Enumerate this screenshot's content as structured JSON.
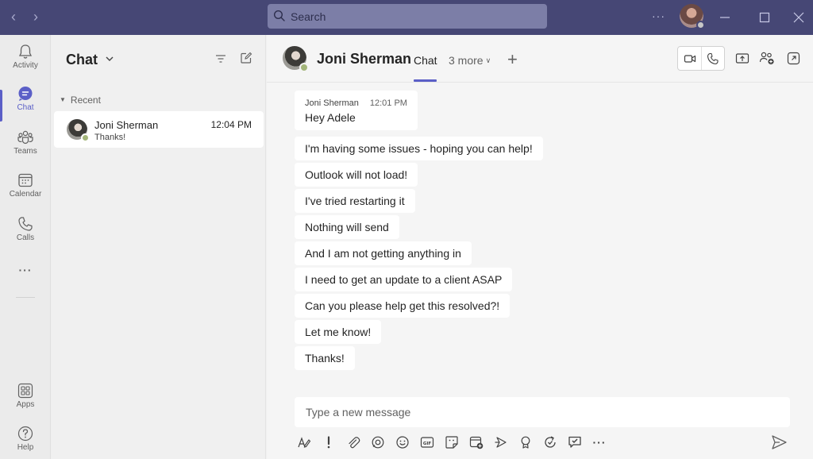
{
  "titlebar": {
    "search_placeholder": "Search",
    "more_label": "···"
  },
  "rail": {
    "items": [
      {
        "label": "Activity"
      },
      {
        "label": "Chat"
      },
      {
        "label": "Teams"
      },
      {
        "label": "Calendar"
      },
      {
        "label": "Calls"
      },
      {
        "label": "Apps"
      },
      {
        "label": "Help"
      }
    ],
    "more_label": "···",
    "active": "Chat"
  },
  "chatlist": {
    "title": "Chat",
    "section": "Recent",
    "items": [
      {
        "name": "Joni Sherman",
        "time": "12:04 PM",
        "preview": "Thanks!"
      }
    ]
  },
  "conversation": {
    "contact_name": "Joni Sherman",
    "tab_chat": "Chat",
    "tab_more": "3 more",
    "add_tab_label": "+",
    "messages": [
      {
        "sender": "Joni Sherman",
        "time": "12:01 PM",
        "text": "Hey Adele"
      },
      {
        "text": "I'm having some issues - hoping you can help!"
      },
      {
        "text": "Outlook will not load!"
      },
      {
        "text": "I've tried restarting it"
      },
      {
        "text": "Nothing will send"
      },
      {
        "text": "And I am not getting anything in"
      },
      {
        "text": "I need to get an update to a client ASAP"
      },
      {
        "text": "Can you please help get this resolved?!"
      },
      {
        "text": "Let me know!"
      },
      {
        "text": "Thanks!"
      }
    ],
    "compose_placeholder": "Type a new message"
  },
  "colors": {
    "titlebar": "#464775",
    "accent": "#5b5fc7",
    "available": "#a3b57a"
  }
}
